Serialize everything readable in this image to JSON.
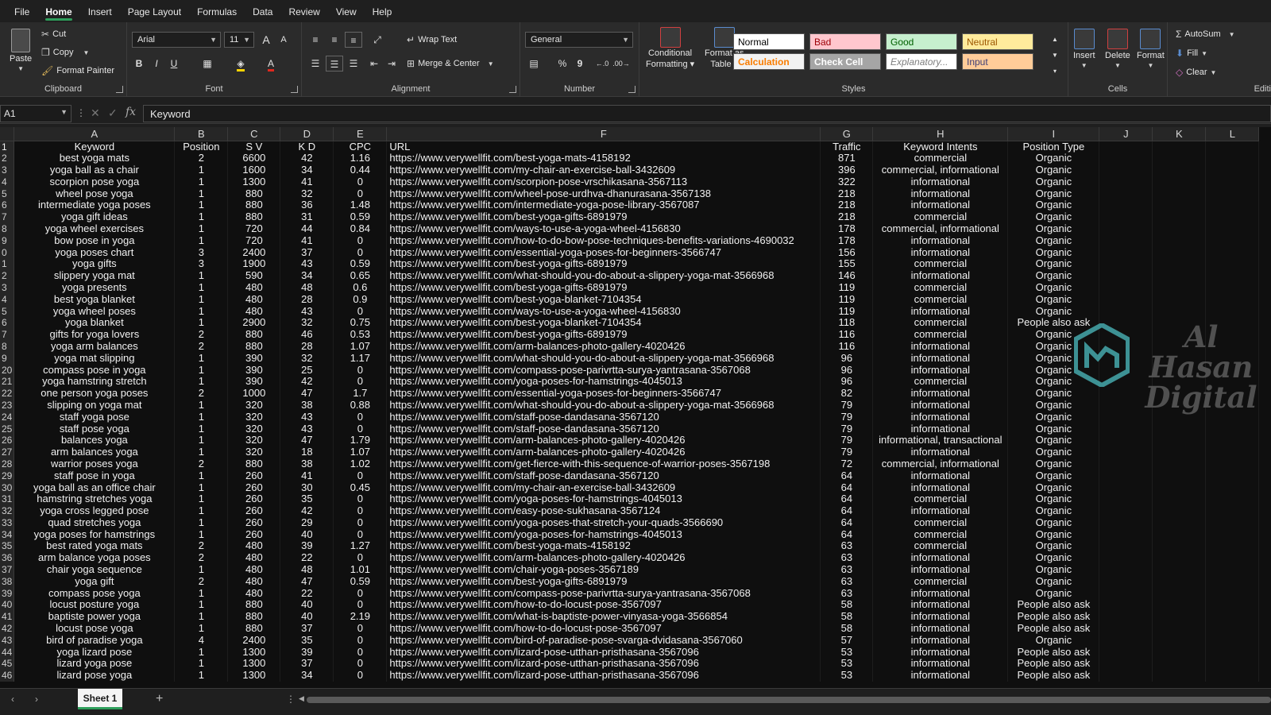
{
  "menu": {
    "tabs": [
      "File",
      "Home",
      "Insert",
      "Page Layout",
      "Formulas",
      "Data",
      "Review",
      "View",
      "Help"
    ],
    "active": "Home"
  },
  "ribbon": {
    "clipboard": {
      "label": "Clipboard",
      "paste": "Paste",
      "cut": "Cut",
      "copy": "Copy",
      "format_painter": "Format Painter"
    },
    "font": {
      "label": "Font",
      "name": "Arial",
      "size": "11",
      "bold": "B",
      "italic": "I",
      "underline": "U",
      "grow": "A",
      "shrink": "A"
    },
    "alignment": {
      "label": "Alignment",
      "wrap_text": "Wrap Text",
      "merge_center": "Merge & Center"
    },
    "number": {
      "label": "Number",
      "format": "General",
      "percent": "%",
      "comma": "9"
    },
    "styles": {
      "label": "Styles",
      "conditional_formatting": [
        "Conditional",
        "Formatting"
      ],
      "format_as_table": [
        "Format as",
        "Table"
      ],
      "cells": [
        {
          "text": "Normal",
          "bg": "#ffffff",
          "fg": "#000000"
        },
        {
          "text": "Bad",
          "bg": "#ffc7ce",
          "fg": "#9c0006"
        },
        {
          "text": "Good",
          "bg": "#c6efce",
          "fg": "#006100"
        },
        {
          "text": "Neutral",
          "bg": "#ffeb9c",
          "fg": "#9c5700"
        },
        {
          "text": "Calculation",
          "bg": "#f2f2f2",
          "fg": "#fa7d00"
        },
        {
          "text": "Check Cell",
          "bg": "#a5a5a5",
          "fg": "#ffffff"
        },
        {
          "text": "Explanatory...",
          "bg": "#ffffff",
          "fg": "#7f7f7f"
        },
        {
          "text": "Input",
          "bg": "#ffcc99",
          "fg": "#3f3f76"
        }
      ]
    },
    "cells_group": {
      "label": "Cells",
      "insert": "Insert",
      "delete": "Delete",
      "format": "Format"
    },
    "editing": {
      "label": "Editi",
      "autosum": "AutoSum",
      "fill": "Fill",
      "clear": "Clear"
    }
  },
  "formula_bar": {
    "name_box": "A1",
    "content": "Keyword"
  },
  "columns": [
    "A",
    "B",
    "C",
    "D",
    "E",
    "F",
    "G",
    "H",
    "I",
    "J",
    "K",
    "L"
  ],
  "row_numbers": [
    "1",
    "2",
    "3",
    "4",
    "5",
    "6",
    "7",
    "8",
    "9",
    "0",
    "1",
    "2",
    "3",
    "4",
    "5",
    "6",
    "7",
    "8",
    "9",
    "20",
    "21",
    "22",
    "23",
    "24",
    "25",
    "26",
    "27",
    "28",
    "29",
    "30",
    "31",
    "32",
    "33",
    "34",
    "35",
    "36",
    "37",
    "38",
    "39",
    "40",
    "41",
    "42",
    "43",
    "44",
    "45",
    "46"
  ],
  "header_row": [
    "Keyword",
    "Position",
    "S V",
    "K D",
    "CPC",
    "URL",
    "Traffic",
    "Keyword Intents",
    "Position Type"
  ],
  "rows": [
    [
      "best yoga mats",
      "2",
      "6600",
      "42",
      "1.16",
      "https://www.verywellfit.com/best-yoga-mats-4158192",
      "871",
      "commercial",
      "Organic"
    ],
    [
      "yoga ball as a chair",
      "1",
      "1600",
      "34",
      "0.44",
      "https://www.verywellfit.com/my-chair-an-exercise-ball-3432609",
      "396",
      "commercial, informational",
      "Organic"
    ],
    [
      "scorpion pose yoga",
      "1",
      "1300",
      "41",
      "0",
      "https://www.verywellfit.com/scorpion-pose-vrschikasana-3567113",
      "322",
      "informational",
      "Organic"
    ],
    [
      "wheel pose yoga",
      "1",
      "880",
      "32",
      "0",
      "https://www.verywellfit.com/wheel-pose-urdhva-dhanurasana-3567138",
      "218",
      "informational",
      "Organic"
    ],
    [
      "intermediate yoga poses",
      "1",
      "880",
      "36",
      "1.48",
      "https://www.verywellfit.com/intermediate-yoga-pose-library-3567087",
      "218",
      "informational",
      "Organic"
    ],
    [
      "yoga gift ideas",
      "1",
      "880",
      "31",
      "0.59",
      "https://www.verywellfit.com/best-yoga-gifts-6891979",
      "218",
      "commercial",
      "Organic"
    ],
    [
      "yoga wheel exercises",
      "1",
      "720",
      "44",
      "0.84",
      "https://www.verywellfit.com/ways-to-use-a-yoga-wheel-4156830",
      "178",
      "commercial, informational",
      "Organic"
    ],
    [
      "bow pose in yoga",
      "1",
      "720",
      "41",
      "0",
      "https://www.verywellfit.com/how-to-do-bow-pose-techniques-benefits-variations-4690032",
      "178",
      "informational",
      "Organic"
    ],
    [
      "yoga poses chart",
      "3",
      "2400",
      "37",
      "0",
      "https://www.verywellfit.com/essential-yoga-poses-for-beginners-3566747",
      "156",
      "informational",
      "Organic"
    ],
    [
      "yoga gifts",
      "3",
      "1900",
      "43",
      "0.59",
      "https://www.verywellfit.com/best-yoga-gifts-6891979",
      "155",
      "commercial",
      "Organic"
    ],
    [
      "slippery yoga mat",
      "1",
      "590",
      "34",
      "0.65",
      "https://www.verywellfit.com/what-should-you-do-about-a-slippery-yoga-mat-3566968",
      "146",
      "informational",
      "Organic"
    ],
    [
      "yoga presents",
      "1",
      "480",
      "48",
      "0.6",
      "https://www.verywellfit.com/best-yoga-gifts-6891979",
      "119",
      "commercial",
      "Organic"
    ],
    [
      "best yoga blanket",
      "1",
      "480",
      "28",
      "0.9",
      "https://www.verywellfit.com/best-yoga-blanket-7104354",
      "119",
      "commercial",
      "Organic"
    ],
    [
      "yoga wheel poses",
      "1",
      "480",
      "43",
      "0",
      "https://www.verywellfit.com/ways-to-use-a-yoga-wheel-4156830",
      "119",
      "informational",
      "Organic"
    ],
    [
      "yoga blanket",
      "1",
      "2900",
      "32",
      "0.75",
      "https://www.verywellfit.com/best-yoga-blanket-7104354",
      "118",
      "commercial",
      "People also ask"
    ],
    [
      "gifts for yoga lovers",
      "2",
      "880",
      "46",
      "0.53",
      "https://www.verywellfit.com/best-yoga-gifts-6891979",
      "116",
      "commercial",
      "Organic"
    ],
    [
      "yoga arm balances",
      "2",
      "880",
      "28",
      "1.07",
      "https://www.verywellfit.com/arm-balances-photo-gallery-4020426",
      "116",
      "informational",
      "Organic"
    ],
    [
      "yoga mat slipping",
      "1",
      "390",
      "32",
      "1.17",
      "https://www.verywellfit.com/what-should-you-do-about-a-slippery-yoga-mat-3566968",
      "96",
      "informational",
      "Organic"
    ],
    [
      "compass pose in yoga",
      "1",
      "390",
      "25",
      "0",
      "https://www.verywellfit.com/compass-pose-parivrtta-surya-yantrasana-3567068",
      "96",
      "informational",
      "Organic"
    ],
    [
      "yoga hamstring stretch",
      "1",
      "390",
      "42",
      "0",
      "https://www.verywellfit.com/yoga-poses-for-hamstrings-4045013",
      "96",
      "commercial",
      "Organic"
    ],
    [
      "one person yoga poses",
      "2",
      "1000",
      "47",
      "1.7",
      "https://www.verywellfit.com/essential-yoga-poses-for-beginners-3566747",
      "82",
      "informational",
      "Organic"
    ],
    [
      "slipping on yoga mat",
      "1",
      "320",
      "38",
      "0.88",
      "https://www.verywellfit.com/what-should-you-do-about-a-slippery-yoga-mat-3566968",
      "79",
      "informational",
      "Organic"
    ],
    [
      "staff yoga pose",
      "1",
      "320",
      "43",
      "0",
      "https://www.verywellfit.com/staff-pose-dandasana-3567120",
      "79",
      "informational",
      "Organic"
    ],
    [
      "staff pose yoga",
      "1",
      "320",
      "43",
      "0",
      "https://www.verywellfit.com/staff-pose-dandasana-3567120",
      "79",
      "informational",
      "Organic"
    ],
    [
      "balances yoga",
      "1",
      "320",
      "47",
      "1.79",
      "https://www.verywellfit.com/arm-balances-photo-gallery-4020426",
      "79",
      "informational, transactional",
      "Organic"
    ],
    [
      "arm balances yoga",
      "1",
      "320",
      "18",
      "1.07",
      "https://www.verywellfit.com/arm-balances-photo-gallery-4020426",
      "79",
      "informational",
      "Organic"
    ],
    [
      "warrior poses yoga",
      "2",
      "880",
      "38",
      "1.02",
      "https://www.verywellfit.com/get-fierce-with-this-sequence-of-warrior-poses-3567198",
      "72",
      "commercial, informational",
      "Organic"
    ],
    [
      "staff pose in yoga",
      "1",
      "260",
      "41",
      "0",
      "https://www.verywellfit.com/staff-pose-dandasana-3567120",
      "64",
      "informational",
      "Organic"
    ],
    [
      "yoga ball as an office chair",
      "1",
      "260",
      "30",
      "0.45",
      "https://www.verywellfit.com/my-chair-an-exercise-ball-3432609",
      "64",
      "informational",
      "Organic"
    ],
    [
      "hamstring stretches yoga",
      "1",
      "260",
      "35",
      "0",
      "https://www.verywellfit.com/yoga-poses-for-hamstrings-4045013",
      "64",
      "commercial",
      "Organic"
    ],
    [
      "yoga cross legged pose",
      "1",
      "260",
      "42",
      "0",
      "https://www.verywellfit.com/easy-pose-sukhasana-3567124",
      "64",
      "informational",
      "Organic"
    ],
    [
      "quad stretches yoga",
      "1",
      "260",
      "29",
      "0",
      "https://www.verywellfit.com/yoga-poses-that-stretch-your-quads-3566690",
      "64",
      "commercial",
      "Organic"
    ],
    [
      "yoga poses for hamstrings",
      "1",
      "260",
      "40",
      "0",
      "https://www.verywellfit.com/yoga-poses-for-hamstrings-4045013",
      "64",
      "commercial",
      "Organic"
    ],
    [
      "best rated yoga mats",
      "2",
      "480",
      "39",
      "1.27",
      "https://www.verywellfit.com/best-yoga-mats-4158192",
      "63",
      "commercial",
      "Organic"
    ],
    [
      "arm balance yoga poses",
      "2",
      "480",
      "22",
      "0",
      "https://www.verywellfit.com/arm-balances-photo-gallery-4020426",
      "63",
      "informational",
      "Organic"
    ],
    [
      "chair yoga sequence",
      "1",
      "480",
      "48",
      "1.01",
      "https://www.verywellfit.com/chair-yoga-poses-3567189",
      "63",
      "informational",
      "Organic"
    ],
    [
      "yoga gift",
      "2",
      "480",
      "47",
      "0.59",
      "https://www.verywellfit.com/best-yoga-gifts-6891979",
      "63",
      "commercial",
      "Organic"
    ],
    [
      "compass pose yoga",
      "1",
      "480",
      "22",
      "0",
      "https://www.verywellfit.com/compass-pose-parivrtta-surya-yantrasana-3567068",
      "63",
      "informational",
      "Organic"
    ],
    [
      "locust posture yoga",
      "1",
      "880",
      "40",
      "0",
      "https://www.verywellfit.com/how-to-do-locust-pose-3567097",
      "58",
      "informational",
      "People also ask"
    ],
    [
      "baptiste power yoga",
      "1",
      "880",
      "40",
      "2.19",
      "https://www.verywellfit.com/what-is-baptiste-power-vinyasa-yoga-3566854",
      "58",
      "informational",
      "People also ask"
    ],
    [
      "locust pose yoga",
      "1",
      "880",
      "37",
      "0",
      "https://www.verywellfit.com/how-to-do-locust-pose-3567097",
      "58",
      "informational",
      "People also ask"
    ],
    [
      "bird of paradise yoga",
      "4",
      "2400",
      "35",
      "0",
      "https://www.verywellfit.com/bird-of-paradise-pose-svarga-dvidasana-3567060",
      "57",
      "informational",
      "Organic"
    ],
    [
      "yoga lizard pose",
      "1",
      "1300",
      "39",
      "0",
      "https://www.verywellfit.com/lizard-pose-utthan-pristhasana-3567096",
      "53",
      "informational",
      "People also ask"
    ],
    [
      "lizard yoga pose",
      "1",
      "1300",
      "37",
      "0",
      "https://www.verywellfit.com/lizard-pose-utthan-pristhasana-3567096",
      "53",
      "informational",
      "People also ask"
    ],
    [
      "lizard pose yoga",
      "1",
      "1300",
      "34",
      "0",
      "https://www.verywellfit.com/lizard-pose-utthan-pristhasana-3567096",
      "53",
      "informational",
      "People also ask"
    ]
  ],
  "watermark": {
    "line1": "Al Hasan",
    "line2": "Digital",
    "color": "#4fc3c7"
  },
  "sheet_tabs": {
    "active": "Sheet 1",
    "add": "+"
  },
  "colors": {
    "accent": "#2e9e5b",
    "background": "#0f0f0f"
  }
}
